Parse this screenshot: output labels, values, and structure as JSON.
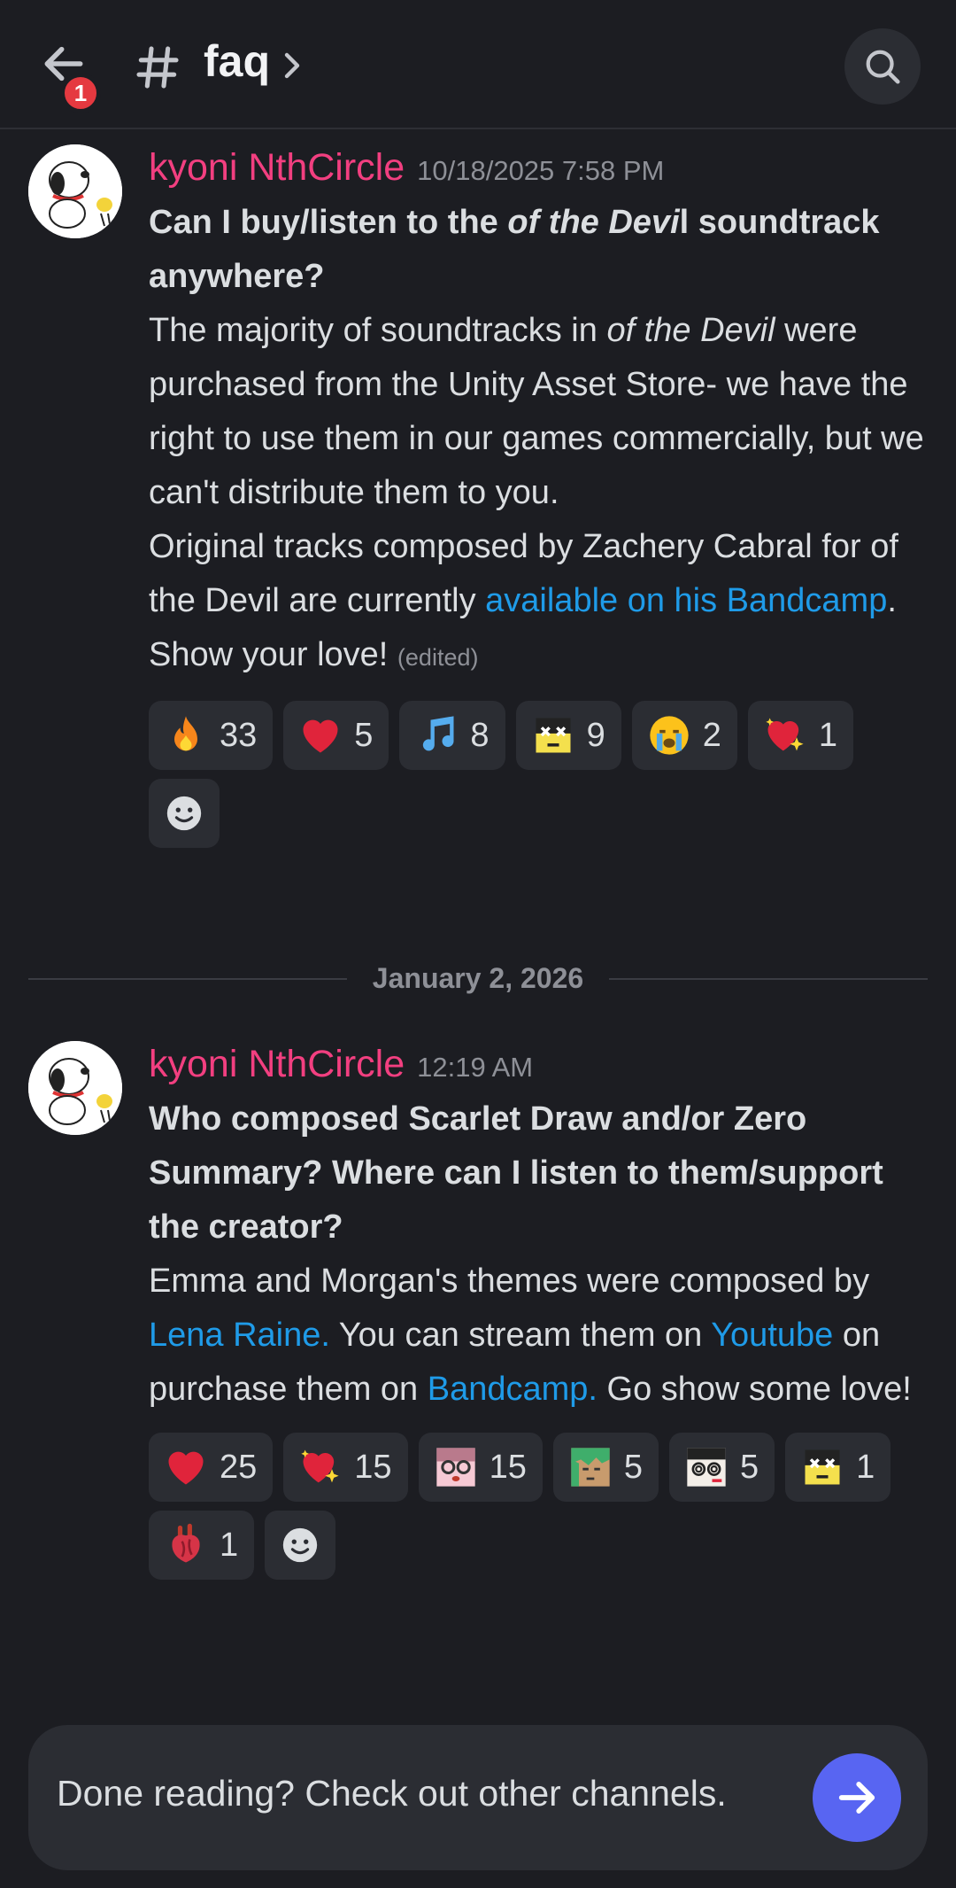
{
  "header": {
    "notification_count": "1",
    "channel_name": "faq"
  },
  "messages": [
    {
      "author": "kyoni NthCircle",
      "timestamp": "10/18/2025 7:58 PM",
      "question_part1": "Can I buy/listen to the ",
      "question_italic": "of the Devi",
      "question_part2": "l soundtrack anywhere?",
      "answer1_part1": "The majority of soundtracks in ",
      "answer1_italic": "of the Devil",
      "answer1_part2": " were purchased from the Unity Asset Store- we have the right to use them in our games commercially, but we can't distribute them to you.",
      "answer2_part1": "Original tracks composed by Zachery Cabral for of the Devil are currently ",
      "answer2_link": "available on his Bandcamp",
      "answer2_part2": ". Show your love! ",
      "edited": "(edited)",
      "reactions": [
        {
          "emoji": "fire-emoji",
          "count": "33"
        },
        {
          "emoji": "red-heart-emoji",
          "count": "5"
        },
        {
          "emoji": "music-note-emoji",
          "count": "8"
        },
        {
          "emoji": "custom-character-emoji",
          "count": "9"
        },
        {
          "emoji": "crying-face-emoji",
          "count": "2"
        },
        {
          "emoji": "sparkling-heart-emoji",
          "count": "1"
        }
      ]
    },
    {
      "author": "kyoni NthCircle",
      "timestamp": "12:19 AM",
      "question": "Who composed Scarlet Draw and/or Zero Summary? Where can I listen to them/support the creator?",
      "answer_part1": "Emma and Morgan's themes were composed by ",
      "answer_link1": "Lena Raine.",
      "answer_part2": " You can stream them on ",
      "answer_link2": "Youtube",
      "answer_part3": " on purchase them on ",
      "answer_link3": "Bandcamp.",
      "answer_part4": " Go show some love!",
      "reactions": [
        {
          "emoji": "red-heart-emoji",
          "count": "25"
        },
        {
          "emoji": "sparkling-heart-emoji",
          "count": "15"
        },
        {
          "emoji": "custom-girl-glasses-emoji",
          "count": "15"
        },
        {
          "emoji": "custom-green-hair-emoji",
          "count": "5"
        },
        {
          "emoji": "custom-spiral-eyes-emoji",
          "count": "5"
        },
        {
          "emoji": "custom-character-emoji",
          "count": "1"
        },
        {
          "emoji": "anatomical-heart-emoji",
          "count": "1"
        }
      ]
    }
  ],
  "date_divider": "January 2, 2026",
  "footer": {
    "prompt": "Done reading? Check out other channels."
  },
  "colors": {
    "background": "#1c1d22",
    "author": "#f23f80",
    "link": "#1f9be8",
    "accent_button": "#5865f2",
    "badge": "#e53940"
  }
}
